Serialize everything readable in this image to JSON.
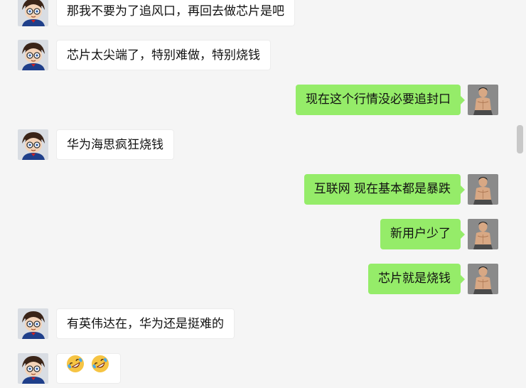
{
  "colors": {
    "background": "#f5f5f5",
    "incoming_bubble": "#ffffff",
    "outgoing_bubble": "#95ec69",
    "scrollbar": "#c8c8c8"
  },
  "avatars": {
    "incoming": "conan-cartoon-avatar",
    "outgoing": "muscular-man-avatar"
  },
  "messages": [
    {
      "side": "left",
      "text": "那我不要为了追风口，再回去做芯片是吧"
    },
    {
      "side": "left",
      "text": "芯片太尖端了，特别难做，特别烧钱"
    },
    {
      "side": "right",
      "text": "现在这个行情没必要追封口"
    },
    {
      "side": "left",
      "text": "华为海思疯狂烧钱"
    },
    {
      "side": "right",
      "text": "互联网 现在基本都是暴跌"
    },
    {
      "side": "right",
      "text": "新用户少了"
    },
    {
      "side": "right",
      "text": "芯片就是烧钱"
    },
    {
      "side": "left",
      "text": "有英伟达在，华为还是挺难的"
    },
    {
      "side": "left",
      "emoji": [
        "rolling-on-floor-laughing-emoji",
        "rolling-on-floor-laughing-emoji"
      ]
    }
  ]
}
